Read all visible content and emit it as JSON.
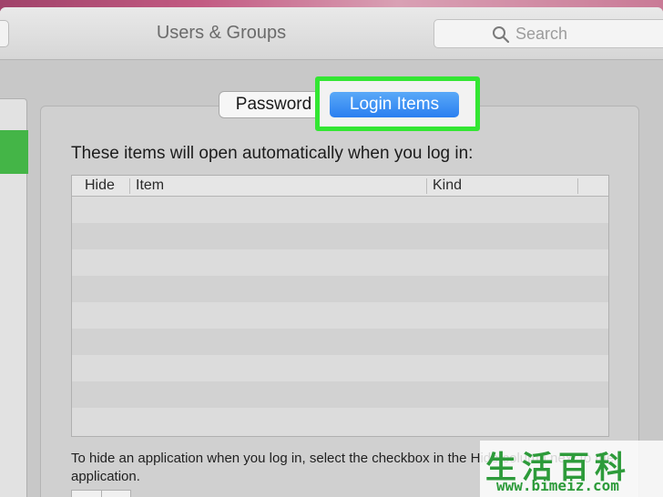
{
  "window": {
    "title": "Users & Groups"
  },
  "search": {
    "placeholder": "Search",
    "icon": "search-icon"
  },
  "tabs": [
    {
      "label": "Password",
      "selected": false
    },
    {
      "label": "Login Items",
      "selected": true
    }
  ],
  "login_items": {
    "instructions": "These items will open automatically when you log in:",
    "columns": [
      "Hide",
      "Item",
      "Kind"
    ],
    "rows": [],
    "footnote": "To hide an application when you log in, select the checkbox in the Hide column next to the application."
  },
  "watermark": {
    "brand": "生活百科",
    "url": "www.bimeiz.com"
  },
  "colors": {
    "highlight": "#33e633",
    "selected_tab": "#2a7ff0",
    "sidebar_selection": "#44b547"
  }
}
